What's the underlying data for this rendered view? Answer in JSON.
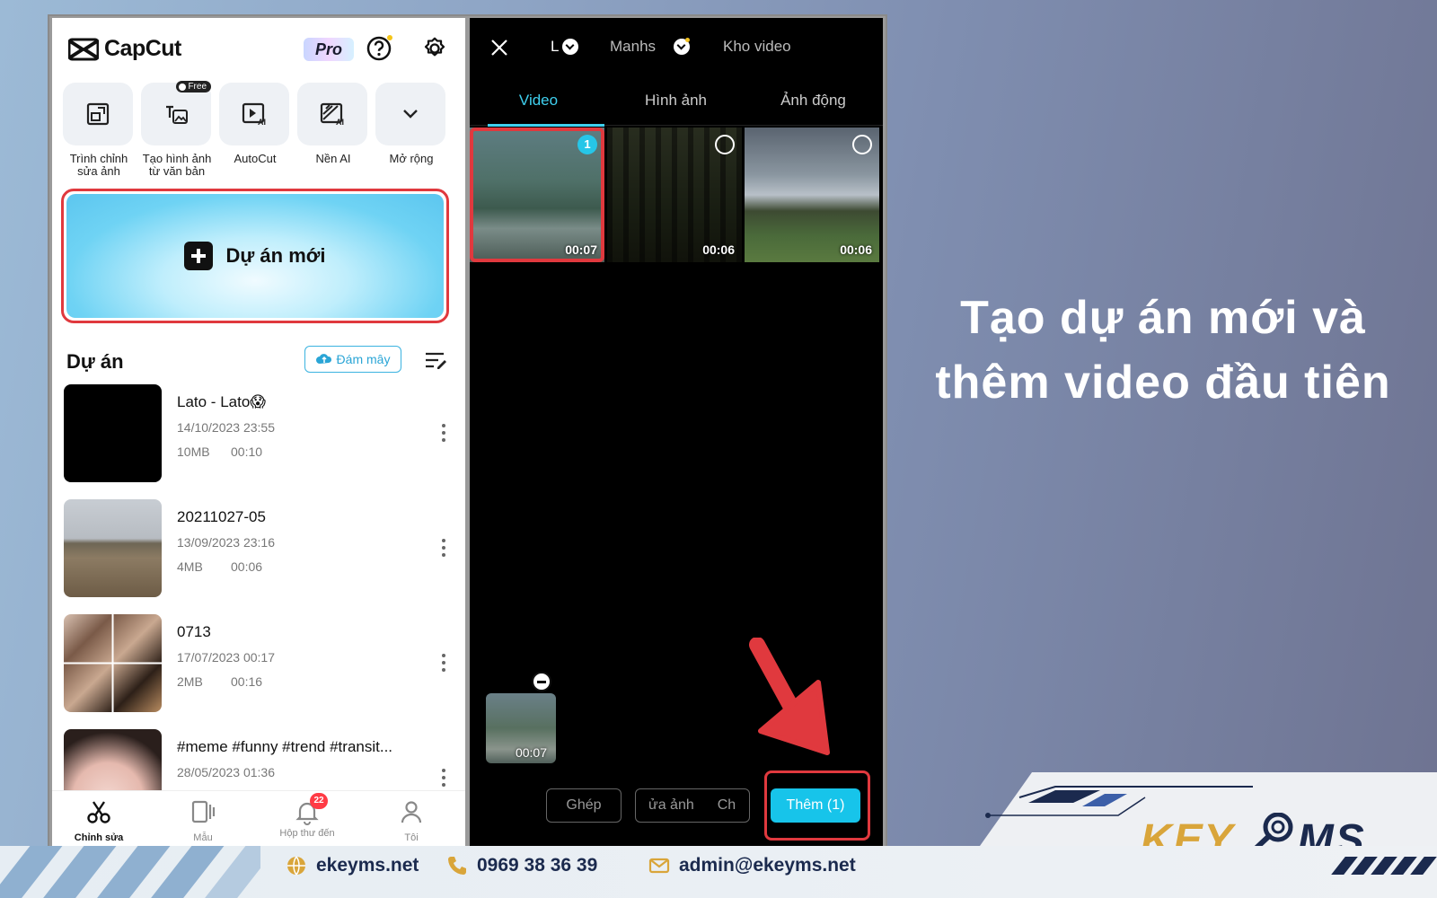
{
  "left_app": {
    "brand": "CapCut",
    "pro_label": "Pro",
    "tools": [
      {
        "label": "Trình chỉnh sửa ảnh",
        "icon": "photo-editor-icon"
      },
      {
        "label": "Tạo hình ảnh từ văn bản",
        "icon": "text-to-image-icon",
        "tag": "Free"
      },
      {
        "label": "AutoCut",
        "icon": "autocut-icon"
      },
      {
        "label": "Nền AI",
        "icon": "ai-background-icon"
      },
      {
        "label": "Mở rộng",
        "icon": "chevron-down-icon"
      }
    ],
    "new_project": "Dự án mới",
    "projects_title": "Dự án",
    "cloud_label": "Đám mây",
    "projects": [
      {
        "title": "Lato - Lato😱",
        "date": "14/10/2023 23:55",
        "size": "10MB",
        "duration": "00:10"
      },
      {
        "title": "20211027-05",
        "date": "13/09/2023 23:16",
        "size": "4MB",
        "duration": "00:06"
      },
      {
        "title": "0713",
        "date": "17/07/2023 00:17",
        "size": "2MB",
        "duration": "00:16"
      },
      {
        "title": "#meme #funny #trend #transit...",
        "date": "28/05/2023 01:36",
        "size": "",
        "duration": ""
      }
    ],
    "nav": [
      {
        "label": "Chỉnh sửa",
        "icon": "scissors-icon",
        "active": true
      },
      {
        "label": "Mẫu",
        "icon": "template-icon"
      },
      {
        "label": "Hộp thư đến",
        "icon": "bell-icon",
        "badge": "22"
      },
      {
        "label": "Tôi",
        "icon": "user-icon"
      }
    ]
  },
  "right_app": {
    "albums": [
      "L",
      "Manhs",
      "Kho video"
    ],
    "tabs": [
      "Video",
      "Hình ảnh",
      "Ảnh động"
    ],
    "media": [
      {
        "duration": "00:07",
        "selected": "1"
      },
      {
        "duration": "00:06"
      },
      {
        "duration": "00:06"
      }
    ],
    "picked_duration": "00:07",
    "btn_merge": "Ghép",
    "btn_edit": "ửa ảnh",
    "btn_edit2": "Ch",
    "btn_add": "Thêm (1)"
  },
  "headline_line1": "Tạo dự án mới và",
  "headline_line2": "thêm video đầu tiên",
  "logo": {
    "part1": "KEY",
    "part2": "MS"
  },
  "footer": {
    "website": "ekeyms.net",
    "phone": "0969 38 36 39",
    "email": "admin@ekeyms.net"
  },
  "colors": {
    "accent": "#17c4ea",
    "highlight": "#e0393e",
    "brand_navy": "#1b2a4e",
    "brand_gold": "#d9a53a"
  }
}
